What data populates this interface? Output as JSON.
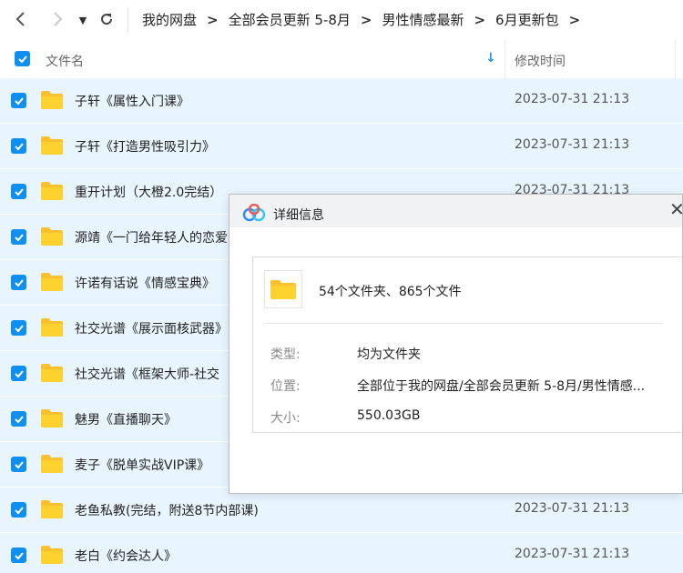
{
  "nav": {
    "back_glyph": "‹",
    "forward_glyph": "›",
    "dropdown_glyph": "▼",
    "refresh_glyph": "↻",
    "breadcrumbs": [
      "我的网盘",
      "全部会员更新 5-8月",
      "男性情感最新",
      "6月更新包"
    ],
    "arrow": ">"
  },
  "table": {
    "col_name": "文件名",
    "col_time": "修改时间",
    "sort_glyph": "↓",
    "rows": [
      {
        "name": "子轩《属性入门课》",
        "time": "2023-07-31 21:13"
      },
      {
        "name": "子轩《打造男性吸引力》",
        "time": "2023-07-31 21:13"
      },
      {
        "name": "重开计划（大橙2.0完结）",
        "time": "2023-07-31 21:13"
      },
      {
        "name": "源靖《一门给年轻人的恋爱",
        "time": ""
      },
      {
        "name": "许诺有话说《情感宝典》",
        "time": ""
      },
      {
        "name": "社交光谱《展示面核武器》",
        "time": ""
      },
      {
        "name": "社交光谱《框架大师-社交",
        "time": ""
      },
      {
        "name": "魅男《直播聊天》",
        "time": ""
      },
      {
        "name": "麦子《脱单实战VIP课》",
        "time": ""
      },
      {
        "name": "老鱼私教(完结，附送8节内部课)",
        "time": "2023-07-31 21:13"
      },
      {
        "name": "老白《约会达人》",
        "time": "2023-07-31 21:13"
      }
    ]
  },
  "dialog": {
    "title": "详细信息",
    "close_glyph": "✕",
    "summary": "54个文件夹、865个文件",
    "fields": [
      {
        "label": "类型:",
        "value": "均为文件夹"
      },
      {
        "label": "位置:",
        "value": "全部位于我的网盘/全部会员更新 5-8月/男性情感..."
      },
      {
        "label": "大小:",
        "value": "550.03GB"
      }
    ]
  },
  "colors": {
    "accent": "#0f8ff2",
    "row_selected_bg": "#e8f4fe",
    "folder_yellow": "#fbc02d"
  },
  "icons": [
    "back-arrow-icon",
    "forward-arrow-icon",
    "dropdown-icon",
    "refresh-icon",
    "checkbox-icon",
    "sort-down-icon",
    "folder-icon",
    "cloud-logo-icon",
    "close-icon"
  ]
}
